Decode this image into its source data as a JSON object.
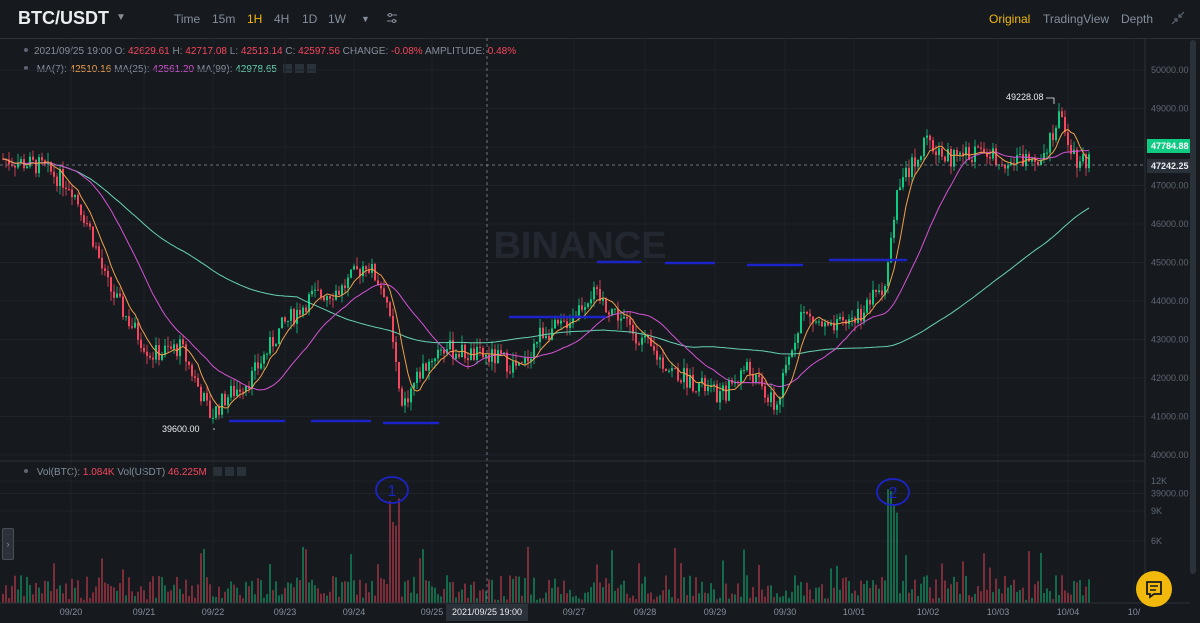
{
  "header": {
    "pair": "BTC/USDT",
    "timeframes": [
      "Time",
      "15m",
      "1H",
      "4H",
      "1D",
      "1W"
    ],
    "active_timeframe": "1H",
    "right_tabs": [
      "Original",
      "TradingView",
      "Depth"
    ],
    "active_right_tab": "Original"
  },
  "ohlc": {
    "date": "2021/09/25 19:00",
    "o_label": "O:",
    "o": "42629.61",
    "h_label": "H:",
    "h": "42717.08",
    "l_label": "L:",
    "l": "42513.14",
    "c_label": "C:",
    "c": "42597.56",
    "change_label": "CHANGE:",
    "change": "-0.08%",
    "amp_label": "AMPLITUDE:",
    "amp": "0.48%"
  },
  "ma": {
    "ma7_label": "MA(7):",
    "ma7": "42510.16",
    "ma25_label": "MA(25):",
    "ma25": "42561.20",
    "ma99_label": "MA(99):",
    "ma99": "42978.65"
  },
  "vol": {
    "label": "Vol(BTC):",
    "btc": "1.084K",
    "usdt_label": "Vol(USDT)",
    "usdt": "46.225M"
  },
  "price_axis": [
    "50000.00",
    "49000.00",
    "48000.00",
    "47000.00",
    "46000.00",
    "45000.00",
    "44000.00",
    "43000.00",
    "42000.00",
    "41000.00",
    "40000.00",
    "39000.00"
  ],
  "volume_axis": [
    "12K",
    "9K",
    "6K"
  ],
  "date_axis": [
    "09/20",
    "09/21",
    "09/22",
    "09/23",
    "09/24",
    "09/25",
    "09/27",
    "09/28",
    "09/29",
    "09/30",
    "10/01",
    "10/02",
    "10/03",
    "10/04",
    "10/"
  ],
  "current_price": "47784.88",
  "crosshair_price": "47242.25",
  "crosshair_time": "2021/09/25 19:00",
  "high_marker": "49228.08",
  "low_marker": "39600.00",
  "watermark": "BINANCE",
  "annotations": [
    "1",
    "2"
  ],
  "colors": {
    "up": "#0ecb81",
    "down": "#f6465d",
    "ma7": "#f0a04b",
    "ma25": "#d453d4",
    "ma99": "#67d2b4",
    "accent": "#f0b90b",
    "annotation": "#1c23c8"
  }
}
